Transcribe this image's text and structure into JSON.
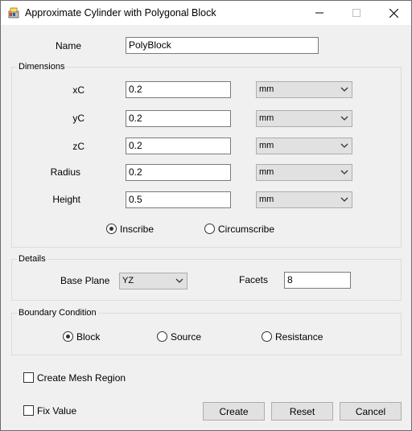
{
  "window": {
    "title": "Approximate Cylinder with Polygonal Block",
    "icons": [
      "app-icon",
      "minimize-icon",
      "maximize-icon",
      "close-icon"
    ]
  },
  "name_field": {
    "label": "Name",
    "value": "PolyBlock"
  },
  "dimensions": {
    "group_label": "Dimensions",
    "rows": [
      {
        "label": "xC",
        "value": "0.2",
        "unit": "mm"
      },
      {
        "label": "yC",
        "value": "0.2",
        "unit": "mm"
      },
      {
        "label": "zC",
        "value": "0.2",
        "unit": "mm"
      },
      {
        "label": "Radius",
        "value": "0.2",
        "unit": "mm"
      },
      {
        "label": "Height",
        "value": "0.5",
        "unit": "mm"
      }
    ],
    "inscribe_label": "Inscribe",
    "circumscribe_label": "Circumscribe",
    "selected": "Inscribe"
  },
  "details": {
    "group_label": "Details",
    "base_plane_label": "Base Plane",
    "base_plane_value": "YZ",
    "facets_label": "Facets",
    "facets_value": "8"
  },
  "boundary": {
    "group_label": "Boundary Condition",
    "options": [
      "Block",
      "Source",
      "Resistance"
    ],
    "selected": "Block"
  },
  "create_mesh_region_label": "Create Mesh Region",
  "create_mesh_region_checked": false,
  "fix_value_label": "Fix Value",
  "fix_value_checked": false,
  "buttons": {
    "create": "Create",
    "reset": "Reset",
    "cancel": "Cancel"
  }
}
